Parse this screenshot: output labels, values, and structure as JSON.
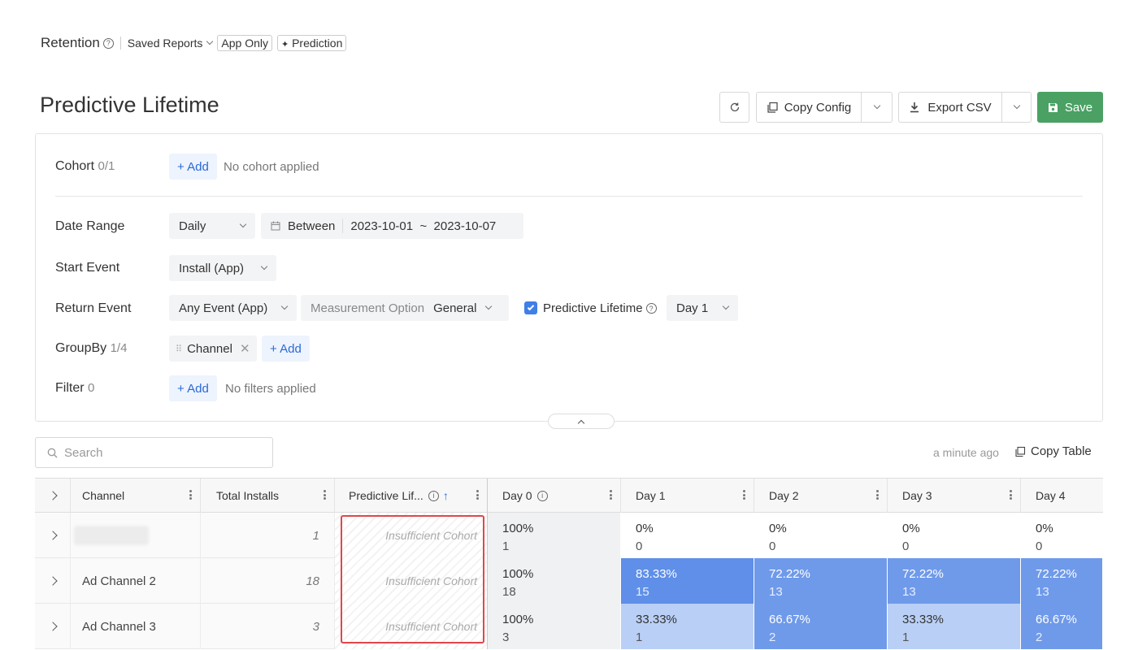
{
  "topbar": {
    "title": "Retention",
    "help_icon": "question-circle-icon",
    "saved_reports": "Saved Reports",
    "tag_app_only": "App Only",
    "tag_prediction": "Prediction",
    "prediction_icon": "sparkle-icon"
  },
  "page": {
    "title": "Predictive Lifetime",
    "refresh_icon": "refresh-icon",
    "copy_config": "Copy Config",
    "export_csv": "Export CSV",
    "save": "Save"
  },
  "panel": {
    "cohort": {
      "label": "Cohort",
      "count": "0/1",
      "add": "+ Add",
      "empty": "No cohort applied"
    },
    "date_range": {
      "label": "Date Range",
      "granularity": "Daily",
      "mode": "Between",
      "range": "2023-10-01  ~  2023-10-07"
    },
    "start_event": {
      "label": "Start Event",
      "value": "Install (App)"
    },
    "return_event": {
      "label": "Return Event",
      "value": "Any Event (App)",
      "measurement_label": "Measurement Option",
      "measurement_value": "General",
      "predictive_checked": true,
      "predictive_label": "Predictive Lifetime",
      "predictive_day": "Day 1"
    },
    "groupby": {
      "label": "GroupBy",
      "count": "1/4",
      "chip": "Channel",
      "add": "+ Add"
    },
    "filter": {
      "label": "Filter",
      "count": "0",
      "add": "+ Add",
      "empty": "No filters applied"
    }
  },
  "toolbar": {
    "search_placeholder": "Search",
    "updated": "a minute ago",
    "copy_table": "Copy Table"
  },
  "table": {
    "headers": {
      "channel": "Channel",
      "total_installs": "Total Installs",
      "predictive": "Predictive Lif...",
      "day0": "Day 0",
      "day1": "Day 1",
      "day2": "Day 2",
      "day3": "Day 3",
      "day4": "Day 4"
    },
    "rows": [
      {
        "channel": "",
        "installs": "1",
        "predictive": "Insufficient Cohort",
        "cells": [
          {
            "p": "100%",
            "c": "1"
          },
          {
            "p": "0%",
            "c": "0"
          },
          {
            "p": "0%",
            "c": "0"
          },
          {
            "p": "0%",
            "c": "0"
          },
          {
            "p": "0%",
            "c": "0"
          }
        ]
      },
      {
        "channel": "Ad Channel 2",
        "installs": "18",
        "predictive": "Insufficient Cohort",
        "cells": [
          {
            "p": "100%",
            "c": "18"
          },
          {
            "p": "83.33%",
            "c": "15"
          },
          {
            "p": "72.22%",
            "c": "13"
          },
          {
            "p": "72.22%",
            "c": "13"
          },
          {
            "p": "72.22%",
            "c": "13"
          }
        ]
      },
      {
        "channel": "Ad Channel 3",
        "installs": "3",
        "predictive": "Insufficient Cohort",
        "cells": [
          {
            "p": "100%",
            "c": "3"
          },
          {
            "p": "33.33%",
            "c": "1"
          },
          {
            "p": "66.67%",
            "c": "2"
          },
          {
            "p": "33.33%",
            "c": "1"
          },
          {
            "p": "66.67%",
            "c": "2"
          }
        ]
      }
    ],
    "colors": {
      "day0_bg": "#f0f1f3",
      "high": "#5f8fe8",
      "mid": "#6f9aea",
      "low": "#b9cff5",
      "highlight_box": "#e0474a"
    }
  }
}
